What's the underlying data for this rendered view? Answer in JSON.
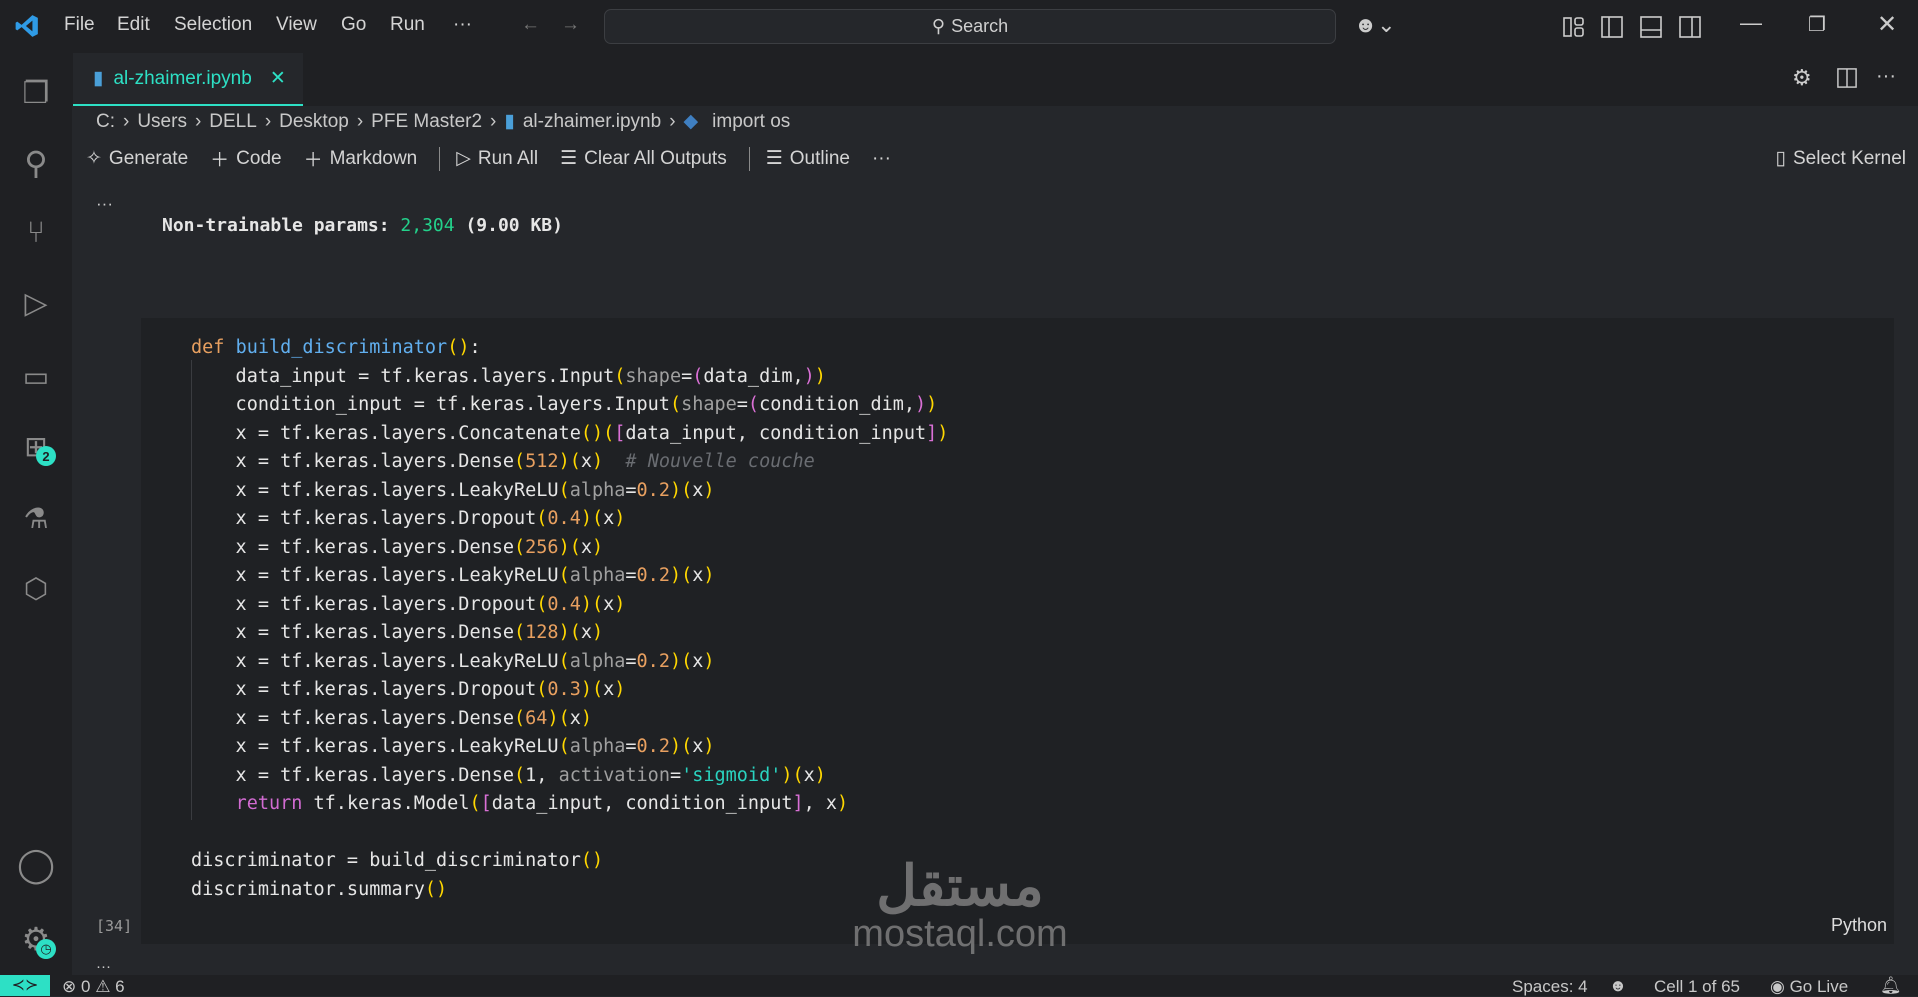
{
  "titlebar": {
    "menus": [
      "File",
      "Edit",
      "Selection",
      "View",
      "Go",
      "Run",
      "···"
    ],
    "search_label": "Search"
  },
  "activity_bar": {
    "extensions_badge": "2"
  },
  "tab": {
    "label": "al-zhaimer.ipynb",
    "close": "✕"
  },
  "breadcrumb": [
    "C:",
    "Users",
    "DELL",
    "Desktop",
    "PFE Master2",
    "al-zhaimer.ipynb",
    "import os"
  ],
  "toolbar": {
    "generate": "Generate",
    "code": "Code",
    "markdown": "Markdown",
    "run_all": "Run All",
    "clear_outputs": "Clear All Outputs",
    "outline": "Outline",
    "more": "···",
    "select_kernel": "Select Kernel"
  },
  "output": {
    "ellipsis": "···",
    "label": "Non-trainable params:",
    "count": "2,304",
    "size": "(9.00 KB)"
  },
  "cell": {
    "execution_count": "[34]",
    "language": "Python",
    "bottom_ellipsis": "···",
    "lines": [
      [
        [
          "def ",
          "kw"
        ],
        [
          "build_discriminator",
          "fn"
        ],
        [
          "(",
          "p1"
        ],
        [
          ")",
          "p1"
        ],
        [
          ":",
          "df"
        ]
      ],
      [
        [
          "    data_input = tf.keras.layers.Input",
          "df"
        ],
        [
          "(",
          "p1"
        ],
        [
          "shape",
          "prm"
        ],
        [
          "=",
          "df"
        ],
        [
          "(",
          "p2"
        ],
        [
          "data_dim,",
          "df"
        ],
        [
          ")",
          "p2"
        ],
        [
          ")",
          "p1"
        ]
      ],
      [
        [
          "    condition_input = tf.keras.layers.Input",
          "df"
        ],
        [
          "(",
          "p1"
        ],
        [
          "shape",
          "prm"
        ],
        [
          "=",
          "df"
        ],
        [
          "(",
          "p2"
        ],
        [
          "condition_dim,",
          "df"
        ],
        [
          ")",
          "p2"
        ],
        [
          ")",
          "p1"
        ]
      ],
      [
        [
          "    x = tf.keras.layers.Concatenate",
          "df"
        ],
        [
          "()",
          "p1"
        ],
        [
          "(",
          "p1"
        ],
        [
          "[",
          "p2"
        ],
        [
          "data_input, condition_input",
          "df"
        ],
        [
          "]",
          "p2"
        ],
        [
          ")",
          "p1"
        ]
      ],
      [
        [
          "    x = tf.keras.layers.Dense",
          "df"
        ],
        [
          "(",
          "p1"
        ],
        [
          "512",
          "num"
        ],
        [
          ")",
          "p1"
        ],
        [
          "(",
          "p1"
        ],
        [
          "x",
          "df"
        ],
        [
          ")",
          "p1"
        ],
        [
          "  # Nouvelle couche",
          "cm"
        ]
      ],
      [
        [
          "    x = tf.keras.layers.LeakyReLU",
          "df"
        ],
        [
          "(",
          "p1"
        ],
        [
          "alpha",
          "prm"
        ],
        [
          "=",
          "df"
        ],
        [
          "0.2",
          "num"
        ],
        [
          ")",
          "p1"
        ],
        [
          "(",
          "p1"
        ],
        [
          "x",
          "df"
        ],
        [
          ")",
          "p1"
        ]
      ],
      [
        [
          "    x = tf.keras.layers.Dropout",
          "df"
        ],
        [
          "(",
          "p1"
        ],
        [
          "0.4",
          "num"
        ],
        [
          ")",
          "p1"
        ],
        [
          "(",
          "p1"
        ],
        [
          "x",
          "df"
        ],
        [
          ")",
          "p1"
        ]
      ],
      [
        [
          "    x = tf.keras.layers.Dense",
          "df"
        ],
        [
          "(",
          "p1"
        ],
        [
          "256",
          "num"
        ],
        [
          ")",
          "p1"
        ],
        [
          "(",
          "p1"
        ],
        [
          "x",
          "df"
        ],
        [
          ")",
          "p1"
        ]
      ],
      [
        [
          "    x = tf.keras.layers.LeakyReLU",
          "df"
        ],
        [
          "(",
          "p1"
        ],
        [
          "alpha",
          "prm"
        ],
        [
          "=",
          "df"
        ],
        [
          "0.2",
          "num"
        ],
        [
          ")",
          "p1"
        ],
        [
          "(",
          "p1"
        ],
        [
          "x",
          "df"
        ],
        [
          ")",
          "p1"
        ]
      ],
      [
        [
          "    x = tf.keras.layers.Dropout",
          "df"
        ],
        [
          "(",
          "p1"
        ],
        [
          "0.4",
          "num"
        ],
        [
          ")",
          "p1"
        ],
        [
          "(",
          "p1"
        ],
        [
          "x",
          "df"
        ],
        [
          ")",
          "p1"
        ]
      ],
      [
        [
          "    x = tf.keras.layers.Dense",
          "df"
        ],
        [
          "(",
          "p1"
        ],
        [
          "128",
          "num"
        ],
        [
          ")",
          "p1"
        ],
        [
          "(",
          "p1"
        ],
        [
          "x",
          "df"
        ],
        [
          ")",
          "p1"
        ]
      ],
      [
        [
          "    x = tf.keras.layers.LeakyReLU",
          "df"
        ],
        [
          "(",
          "p1"
        ],
        [
          "alpha",
          "prm"
        ],
        [
          "=",
          "df"
        ],
        [
          "0.2",
          "num"
        ],
        [
          ")",
          "p1"
        ],
        [
          "(",
          "p1"
        ],
        [
          "x",
          "df"
        ],
        [
          ")",
          "p1"
        ]
      ],
      [
        [
          "    x = tf.keras.layers.Dropout",
          "df"
        ],
        [
          "(",
          "p1"
        ],
        [
          "0.3",
          "num"
        ],
        [
          ")",
          "p1"
        ],
        [
          "(",
          "p1"
        ],
        [
          "x",
          "df"
        ],
        [
          ")",
          "p1"
        ]
      ],
      [
        [
          "    x = tf.keras.layers.Dense",
          "df"
        ],
        [
          "(",
          "p1"
        ],
        [
          "64",
          "num"
        ],
        [
          ")",
          "p1"
        ],
        [
          "(",
          "p1"
        ],
        [
          "x",
          "df"
        ],
        [
          ")",
          "p1"
        ]
      ],
      [
        [
          "    x = tf.keras.layers.LeakyReLU",
          "df"
        ],
        [
          "(",
          "p1"
        ],
        [
          "alpha",
          "prm"
        ],
        [
          "=",
          "df"
        ],
        [
          "0.2",
          "num"
        ],
        [
          ")",
          "p1"
        ],
        [
          "(",
          "p1"
        ],
        [
          "x",
          "df"
        ],
        [
          ")",
          "p1"
        ]
      ],
      [
        [
          "    x = tf.keras.layers.Dense",
          "df"
        ],
        [
          "(",
          "p1"
        ],
        [
          "1, ",
          "df"
        ],
        [
          "activation",
          "prm"
        ],
        [
          "=",
          "df"
        ],
        [
          "'sigmoid'",
          "str"
        ],
        [
          ")",
          "p1"
        ],
        [
          "(",
          "p1"
        ],
        [
          "x",
          "df"
        ],
        [
          ")",
          "p1"
        ]
      ],
      [
        [
          "    ",
          "df"
        ],
        [
          "return",
          "ret"
        ],
        [
          " tf.keras.Model",
          "df"
        ],
        [
          "(",
          "p1"
        ],
        [
          "[",
          "p2"
        ],
        [
          "data_input, condition_input",
          "df"
        ],
        [
          "]",
          "p2"
        ],
        [
          ", x",
          "df"
        ],
        [
          ")",
          "p1"
        ]
      ],
      [
        [
          "",
          "df"
        ]
      ],
      [
        [
          "discriminator = build_discriminator",
          "df"
        ],
        [
          "()",
          "p1"
        ]
      ],
      [
        [
          "discriminator.summary",
          "df"
        ],
        [
          "()",
          "p1"
        ]
      ]
    ]
  },
  "status": {
    "errors": "0",
    "warnings": "6",
    "spaces": "Spaces: 4",
    "cell_pos": "Cell 1 of 65",
    "go_live": "Go Live"
  },
  "watermark": {
    "arabic": "مستقل",
    "latin": "mostaql.com"
  },
  "colors": {
    "accent": "#2de0c5",
    "number_green": "#23d18b"
  }
}
